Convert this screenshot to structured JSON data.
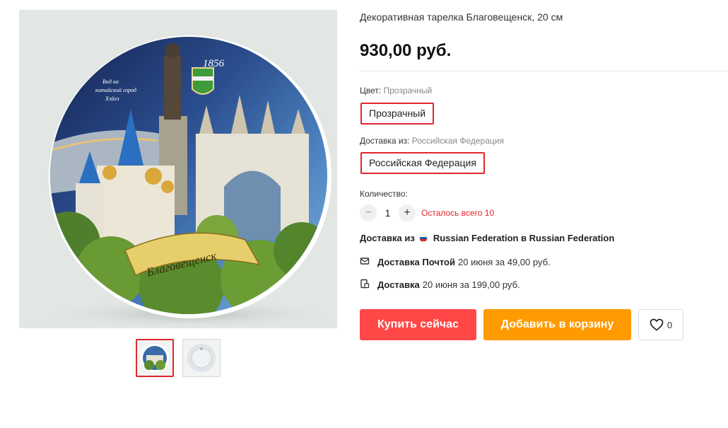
{
  "product": {
    "title": "Декоративная тарелка Благовещенск, 20 см",
    "price": "930,00 руб.",
    "plate_year": "1856",
    "plate_banner": "Благовещенск",
    "plate_caption": [
      "Вид на",
      "китайский город",
      "Хэйхэ"
    ]
  },
  "gallery": {
    "thumbnails": [
      "plate-front",
      "plate-back"
    ],
    "active_index": 0
  },
  "color_option": {
    "label": "Цвет:",
    "value": "Прозрачный",
    "selected": "Прозрачный"
  },
  "ship_option": {
    "label": "Доставка из:",
    "value": "Российская Федерация",
    "selected": "Российская Федерация"
  },
  "quantity": {
    "label": "Количество:",
    "value": "1",
    "minus": "−",
    "plus": "+",
    "stock_note": "Осталось всего 10"
  },
  "shipping": {
    "prefix": "Доставка из",
    "route": "Russian Federation в Russian Federation",
    "flag_colors": [
      "#ffffff",
      "#1c57a5",
      "#d52b1e"
    ]
  },
  "delivery_methods": [
    {
      "icon": "mail-truck-icon",
      "name": "Доставка Почтой",
      "detail": "20 июня за 49,00 руб."
    },
    {
      "icon": "courier-icon",
      "name": "Доставка",
      "detail": "20 июня за 199,00 руб."
    }
  ],
  "actions": {
    "buy_now": "Купить сейчас",
    "add_to_cart": "Добавить в корзину",
    "wishlist_count": "0"
  },
  "colors": {
    "accent_red": "#ff4747",
    "accent_orange": "#ff9a00",
    "stock_red": "#e0262c"
  }
}
